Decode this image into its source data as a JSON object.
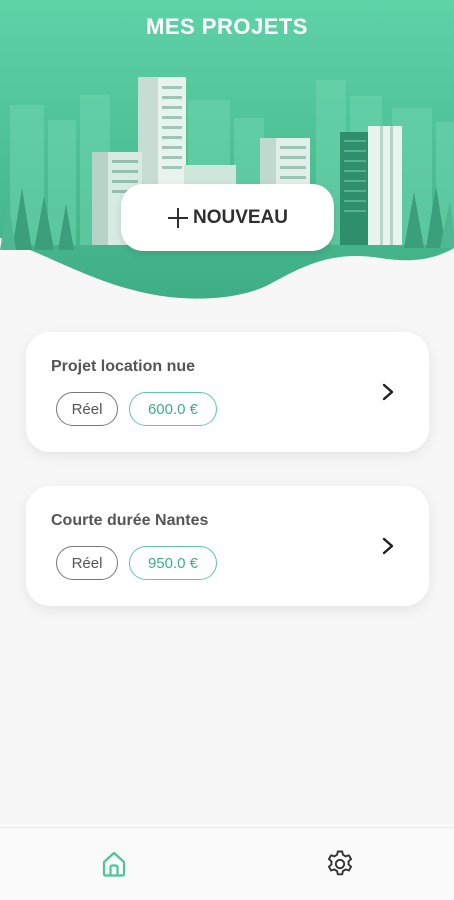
{
  "header": {
    "title": "MES PROJETS",
    "new_button_label": "NOUVEAU"
  },
  "projects": [
    {
      "name": "Projet location nue",
      "type": "Réel",
      "amount": "600.0 €"
    },
    {
      "name": "Courte durée Nantes",
      "type": "Réel",
      "amount": "950.0 €"
    }
  ],
  "bottom_nav": {
    "items": [
      {
        "icon": "home-icon",
        "active": true
      },
      {
        "icon": "gear-icon",
        "active": false
      }
    ]
  },
  "colors": {
    "primary": "#5ecfa2",
    "chip_amount": "#3dae86",
    "background": "#f7f7f7",
    "card": "#ffffff"
  }
}
